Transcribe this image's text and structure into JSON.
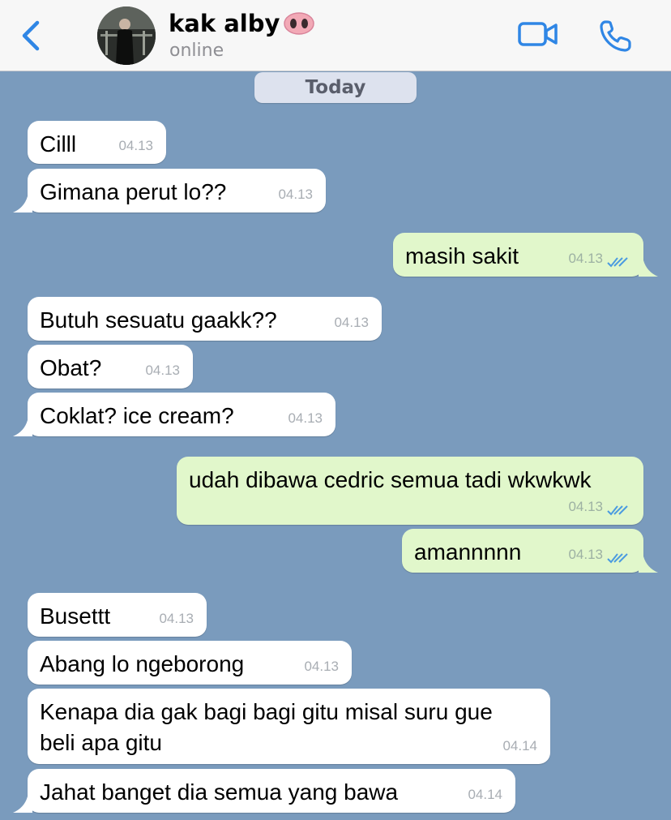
{
  "header": {
    "back_icon": "chevron-left-icon",
    "contact_name": "kak alby",
    "status": "online",
    "emoji": "pig-nose",
    "video_icon": "video-camera-icon",
    "call_icon": "phone-icon",
    "accent": "#2f86e5"
  },
  "chat": {
    "date_label": "Today",
    "messages": [
      {
        "dir": "in",
        "text": "Cilll",
        "time": "04.13"
      },
      {
        "dir": "in",
        "text": "Gimana perut lo??",
        "time": "04.13"
      },
      {
        "dir": "out",
        "text": "masih sakit",
        "time": "04.13",
        "read": true
      },
      {
        "dir": "in",
        "text": "Butuh sesuatu gaakk??",
        "time": "04.13"
      },
      {
        "dir": "in",
        "text": "Obat?",
        "time": "04.13"
      },
      {
        "dir": "in",
        "text": "Coklat? ice cream?",
        "time": "04.13"
      },
      {
        "dir": "out",
        "text": "udah dibawa cedric semua tadi wkwkwk",
        "time": "04.13",
        "read": true
      },
      {
        "dir": "out",
        "text": "amannnnn",
        "time": "04.13",
        "read": true
      },
      {
        "dir": "in",
        "text": "Busettt",
        "time": "04.13"
      },
      {
        "dir": "in",
        "text": "Abang lo ngeborong",
        "time": "04.13"
      },
      {
        "dir": "in",
        "text_line1": "Kenapa dia gak bagi bagi gitu misal suru gue",
        "text_line2": "beli apa gitu",
        "time": "04.14"
      },
      {
        "dir": "in",
        "text": "Jahat banget dia semua yang bawa",
        "time": "04.14"
      }
    ]
  },
  "colors": {
    "chat_background": "#7a9bbd",
    "incoming_bubble": "#ffffff",
    "outgoing_bubble": "#e1f7cb",
    "read_ticks": "#4b9be0"
  }
}
